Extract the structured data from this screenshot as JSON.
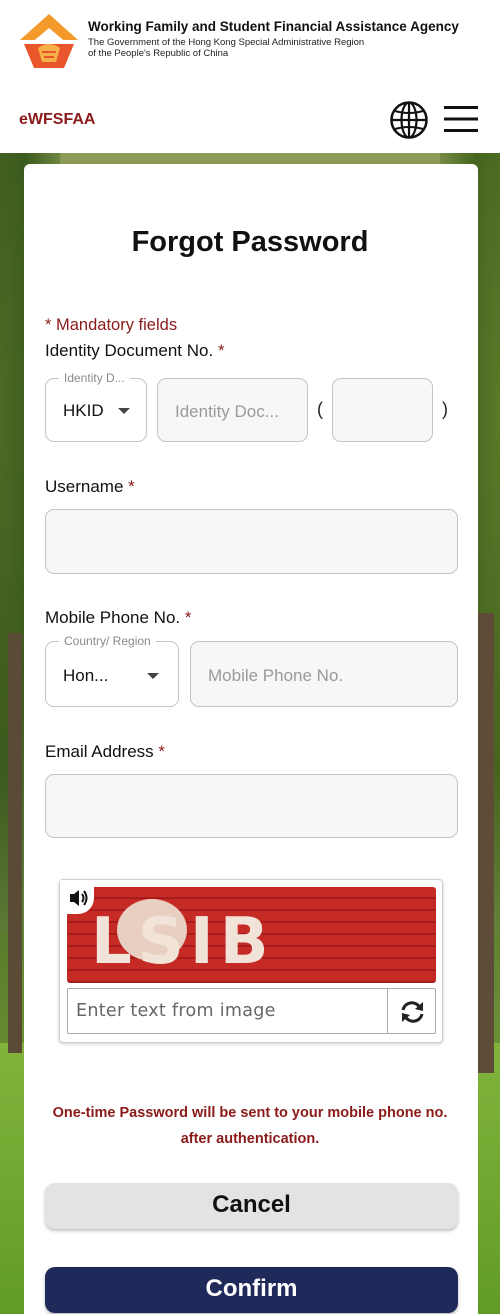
{
  "header": {
    "agency_name": "Working Family and Student Financial Assistance Agency",
    "gov_line1": "The Government of the Hong Kong Special Administrative Region",
    "gov_line2": "of the People's Republic of China",
    "app_name": "eWFSFAA",
    "brand_color": "#e8562a",
    "language_icon": "globe-icon",
    "menu_icon": "hamburger-menu-icon"
  },
  "form": {
    "title": "Forgot Password",
    "mandatory_note": "* Mandatory fields",
    "id_doc": {
      "label": "Identity Document No.",
      "required_mark": "*",
      "type_float_label": "Identity D...",
      "type_value": "HKID",
      "number_placeholder": "Identity Doc...",
      "check_digit_value": "",
      "paren_open": "(",
      "paren_close": ")"
    },
    "username": {
      "label": "Username",
      "required_mark": "*",
      "value": ""
    },
    "mobile": {
      "label": "Mobile Phone No.",
      "required_mark": "*",
      "country_float_label": "Country/ Region",
      "country_value": "Hon...",
      "number_placeholder": "Mobile Phone No."
    },
    "email": {
      "label": "Email Address",
      "required_mark": "*",
      "value": ""
    },
    "captcha": {
      "image_text": "LSIB",
      "input_placeholder": "Enter text from image",
      "audio_icon": "speaker-icon",
      "refresh_icon": "refresh-icon"
    },
    "otp_note": "One-time Password will be sent to your mobile phone no. after authentication.",
    "cancel_label": "Cancel",
    "confirm_label": "Confirm"
  },
  "colors": {
    "accent_red": "#8b1a1a",
    "confirm_bg": "#1f2a5a",
    "cancel_bg": "#e3e3e3"
  }
}
